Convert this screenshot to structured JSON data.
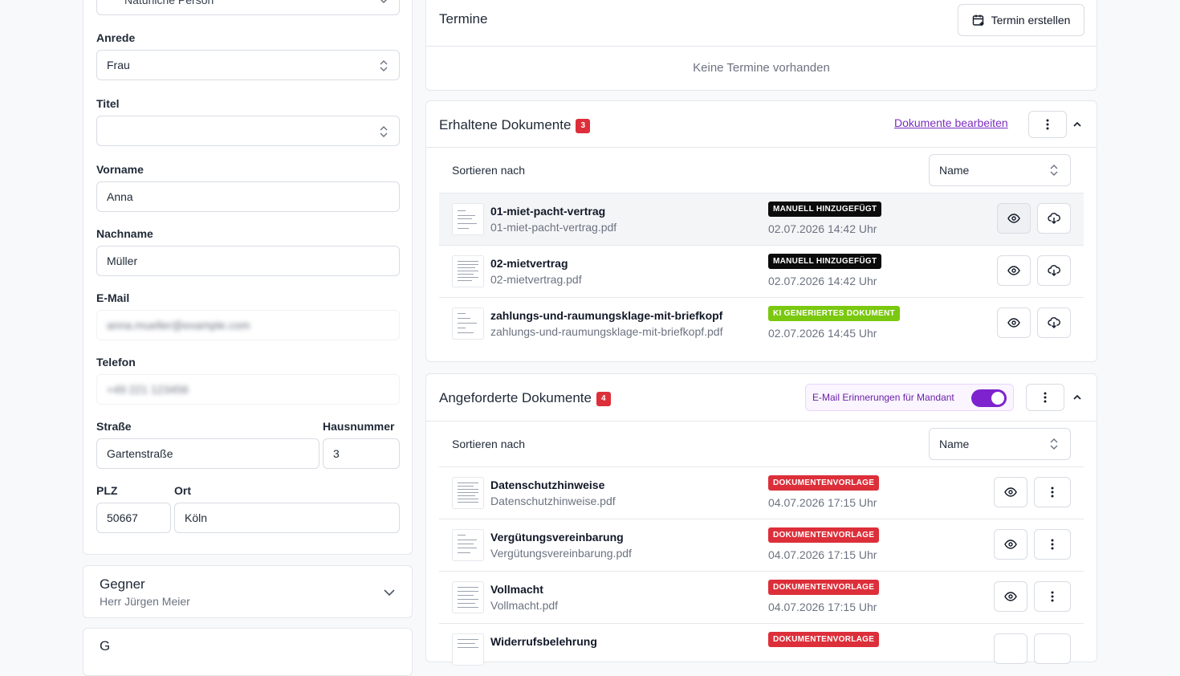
{
  "form": {
    "person_type": "Natürliche Person",
    "anrede_label": "Anrede",
    "anrede_value": "Frau",
    "titel_label": "Titel",
    "titel_value": "",
    "vorname_label": "Vorname",
    "vorname_value": "Anna",
    "nachname_label": "Nachname",
    "nachname_value": "Müller",
    "email_label": "E-Mail",
    "email_value": "anna.mueller@example.com",
    "telefon_label": "Telefon",
    "telefon_value": "+49 221 123456",
    "strasse_label": "Straße",
    "strasse_value": "Gartenstraße",
    "hausnummer_label": "Hausnummer",
    "hausnummer_value": "3",
    "plz_label": "PLZ",
    "plz_value": "50667",
    "ort_label": "Ort",
    "ort_value": "Köln"
  },
  "gegner": {
    "title": "Gegner",
    "subtitle": "Herr Jürgen Meier"
  },
  "third_card": {
    "title": "G"
  },
  "termine": {
    "title": "Termine",
    "create_label": "Termin erstellen",
    "empty_text": "Keine Termine vorhanden"
  },
  "erhaltene": {
    "title": "Erhaltene Dokumente",
    "count": "3",
    "edit_link": "Dokumente bearbeiten",
    "sort_label": "Sortieren nach",
    "sort_value": "Name",
    "docs": [
      {
        "name": "01-miet-pacht-vertrag",
        "file": "01-miet-pacht-vertrag.pdf",
        "tag": "MANUELL HINZUGEFÜGT",
        "date": "02.07.2026 14:42 Uhr"
      },
      {
        "name": "02-mietvertrag",
        "file": "02-mietvertrag.pdf",
        "tag": "MANUELL HINZUGEFÜGT",
        "date": "02.07.2026 14:42 Uhr"
      },
      {
        "name": "zahlungs-und-raumungsklage-mit-briefkopf",
        "file": "zahlungs-und-raumungsklage-mit-briefkopf.pdf",
        "tag": "KI GENERIERTES DOKUMENT",
        "date": "02.07.2026 14:45 Uhr"
      }
    ]
  },
  "angeforderte": {
    "title": "Angeforderte Dokumente",
    "count": "4",
    "toggle_label": "E-Mail Erinnerungen für Mandant",
    "toggle_on": true,
    "sort_label": "Sortieren nach",
    "sort_value": "Name",
    "docs": [
      {
        "name": "Datenschutzhinweise",
        "file": "Datenschutzhinweise.pdf",
        "tag": "DOKUMENTENVORLAGE",
        "date": "04.07.2026 17:15 Uhr"
      },
      {
        "name": "Vergütungsvereinbarung",
        "file": "Vergütungsvereinbarung.pdf",
        "tag": "DOKUMENTENVORLAGE",
        "date": "04.07.2026 17:15 Uhr"
      },
      {
        "name": "Vollmacht",
        "file": "Vollmacht.pdf",
        "tag": "DOKUMENTENVORLAGE",
        "date": "04.07.2026 17:15 Uhr"
      },
      {
        "name": "Widerrufsbelehrung",
        "file": "",
        "tag": "DOKUMENTENVORLAGE",
        "date": ""
      }
    ]
  },
  "colors": {
    "accent": "#7e22ce",
    "danger": "#dc2f3a",
    "ai_green": "#7ac80f"
  }
}
